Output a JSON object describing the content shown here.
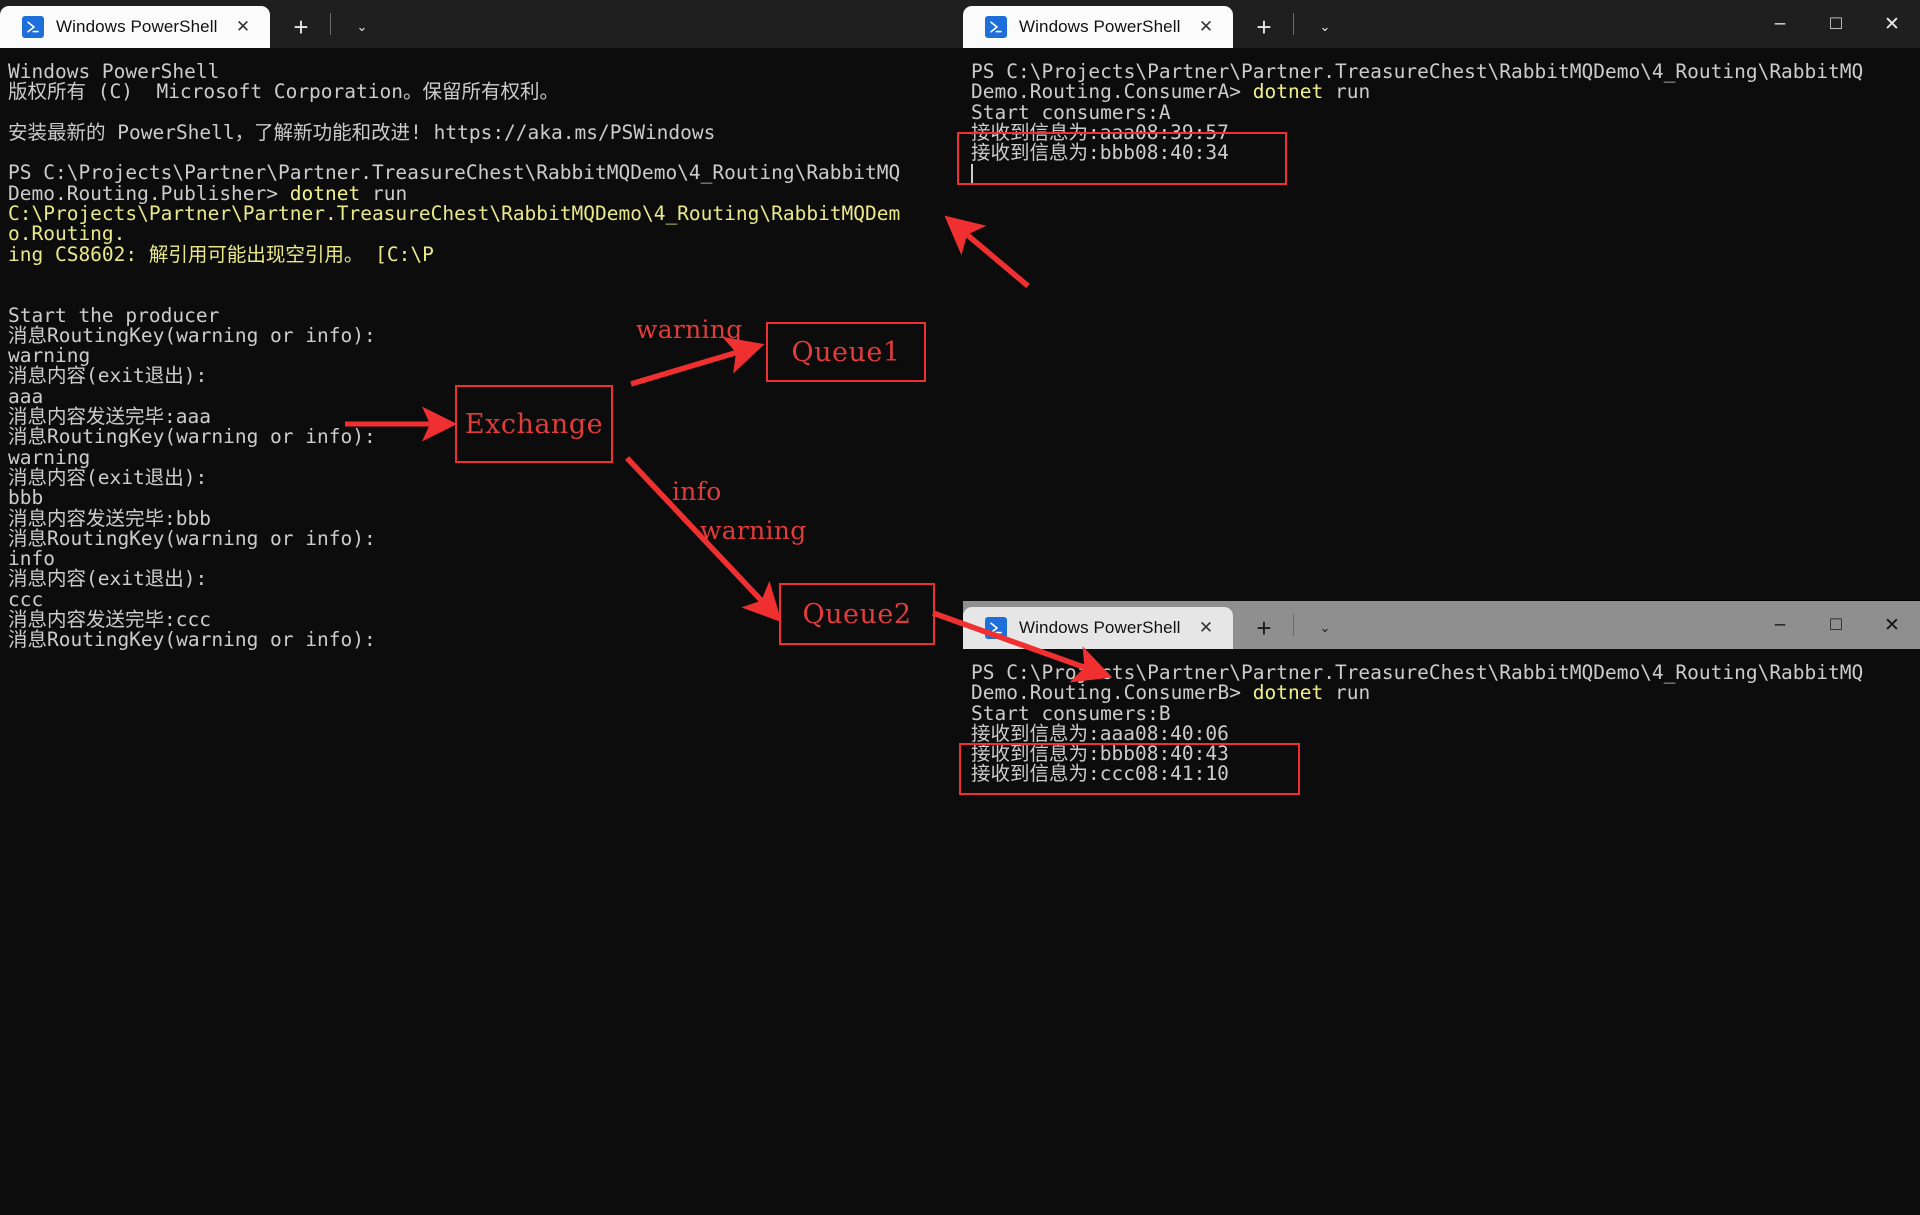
{
  "windows": {
    "publisher": {
      "tab_title": "Windows PowerShell",
      "close_label": "✕",
      "new_tab_label": "+",
      "dropdown_label": "⌄",
      "minimize_label": "–",
      "maximize_label": "□",
      "window_close_label": "✕",
      "console_lines": [
        {
          "text": "Windows PowerShell",
          "color": "normal"
        },
        {
          "text": "版权所有 (C)  Microsoft Corporation。保留所有权利。",
          "color": "normal"
        },
        {
          "text": "",
          "color": "normal"
        },
        {
          "text": "安装最新的 PowerShell，了解新功能和改进! https://aka.ms/PSWindows",
          "color": "normal"
        },
        {
          "text": "",
          "color": "normal"
        },
        {
          "text": "PS C:\\Projects\\Partner\\Partner.TreasureChest\\RabbitMQDemo\\4_Routing\\RabbitMQ",
          "color": "normal"
        },
        {
          "text": "Demo.Routing.Publisher> dotnet run",
          "color": "prompt"
        },
        {
          "text": "C:\\Projects\\Partner\\Partner.TreasureChest\\RabbitMQDemo\\4_Routing\\RabbitMQDem",
          "color": "yellow"
        },
        {
          "text": "o.Routing.",
          "color": "yellow"
        },
        {
          "text": "ing CS8602: 解引用可能出现空引用。 [C:\\P",
          "color": "yellow"
        },
        {
          "text": "",
          "color": "normal"
        },
        {
          "text": "",
          "color": "normal"
        },
        {
          "text": "Start the producer",
          "color": "normal"
        },
        {
          "text": "消息RoutingKey(warning or info):",
          "color": "normal"
        },
        {
          "text": "warning",
          "color": "normal"
        },
        {
          "text": "消息内容(exit退出):",
          "color": "normal"
        },
        {
          "text": "aaa",
          "color": "normal"
        },
        {
          "text": "消息内容发送完毕:aaa",
          "color": "normal"
        },
        {
          "text": "消息RoutingKey(warning or info):",
          "color": "normal"
        },
        {
          "text": "warning",
          "color": "normal"
        },
        {
          "text": "消息内容(exit退出):",
          "color": "normal"
        },
        {
          "text": "bbb",
          "color": "normal"
        },
        {
          "text": "消息内容发送完毕:bbb",
          "color": "normal"
        },
        {
          "text": "消息RoutingKey(warning or info):",
          "color": "normal"
        },
        {
          "text": "info",
          "color": "normal"
        },
        {
          "text": "消息内容(exit退出):",
          "color": "normal"
        },
        {
          "text": "ccc",
          "color": "normal"
        },
        {
          "text": "消息内容发送完毕:ccc",
          "color": "normal"
        },
        {
          "text": "消息RoutingKey(warning or info):",
          "color": "normal"
        }
      ],
      "console_text": "Windows PowerShell\n版权所有 (C)  Microsoft Corporation。保留所有权利。\n\n安装最新的 PowerShell，了解新功能和改进! https://aka.ms/PSWindows\n"
    },
    "consumerA": {
      "tab_title": "Windows PowerShell",
      "close_label": "✕",
      "new_tab_label": "+",
      "dropdown_label": "⌄",
      "minimize_label": "–",
      "maximize_label": "□",
      "window_close_label": "✕",
      "prompt_line1": "PS C:\\Projects\\Partner\\Partner.TreasureChest\\RabbitMQDemo\\4_Routing\\RabbitMQ",
      "prompt_line2_path": "Demo.Routing.ConsumerA> ",
      "prompt_line2_cmd": "dotnet",
      "prompt_line2_arg": " run",
      "start_line": "Start consumers:A",
      "received": [
        "接收到信息为:aaa08:39:57",
        "接收到信息为:bbb08:40:34"
      ]
    },
    "consumerB": {
      "tab_title": "Windows PowerShell",
      "close_label": "✕",
      "new_tab_label": "+",
      "dropdown_label": "⌄",
      "minimize_label": "–",
      "maximize_label": "□",
      "window_close_label": "✕",
      "prompt_line1": "PS C:\\Projects\\Partner\\Partner.TreasureChest\\RabbitMQDemo\\4_Routing\\RabbitMQ",
      "prompt_line2_path": "Demo.Routing.ConsumerB> ",
      "prompt_line2_cmd": "dotnet",
      "prompt_line2_arg": " run",
      "start_line": "Start consumers:B",
      "received_highlighted": [
        "接收到信息为:aaa08:40:06",
        "接收到信息为:bbb08:40:43"
      ],
      "received_extra": "接收到信息为:ccc08:41:10"
    }
  },
  "annotations": {
    "color": "#f03030",
    "exchange_box": "Exchange",
    "queue1_box": "Queue1",
    "queue2_box": "Queue2",
    "label_warning_top": "warning",
    "label_info": "info",
    "label_warning_bottom": "warning"
  }
}
